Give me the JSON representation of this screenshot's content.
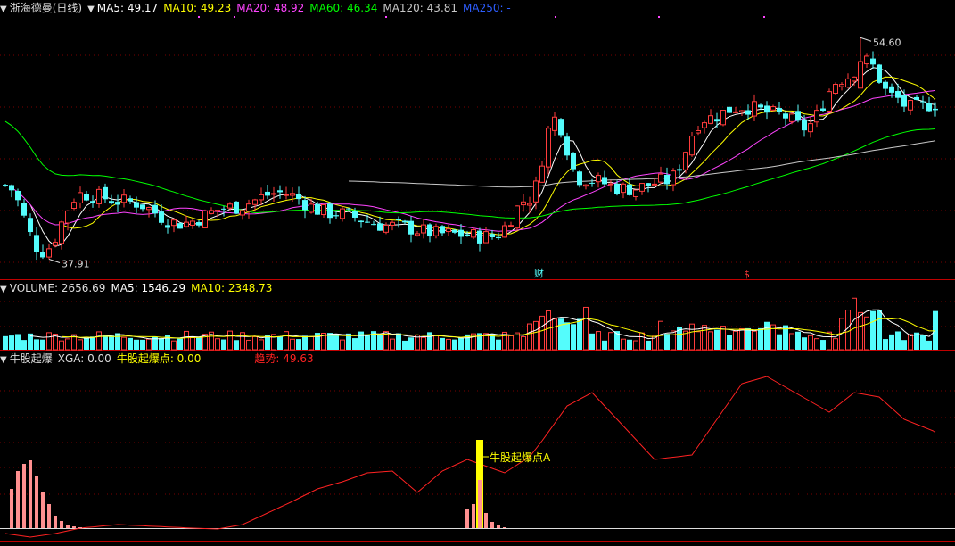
{
  "header": {
    "stock_name": "浙海德曼(日线)",
    "ma5": "MA5: 49.17",
    "ma10": "MA10: 49.23",
    "ma20": "MA20: 48.92",
    "ma60": "MA60: 46.34",
    "ma120": "MA120: 43.81",
    "ma250": "MA250: -"
  },
  "volume_header": {
    "title": "VOLUME: 2656.69",
    "ma5": "MA5: 1546.29",
    "ma10": "MA10: 2348.73"
  },
  "indicator_header": {
    "title": "牛股起爆",
    "xga": "XGA: 0.00",
    "point": "牛股起爆点: 0.00",
    "trend": "趋势: 49.63"
  },
  "price_panel": {
    "high_label": "54.60",
    "low_label": "37.91",
    "marker_cai": "财",
    "marker_s": "$"
  },
  "indicator_panel": {
    "annotation": "牛股起爆点A"
  },
  "colors": {
    "up": "#ff3c3c",
    "down": "#54fcfc",
    "ma5": "#ffffff",
    "ma10": "#ffff00",
    "ma20": "#ff44ff",
    "ma60": "#00ff00",
    "ma120": "#c8c8c8",
    "ma250": "#2d5dff",
    "trend": "#ff2222",
    "xga_bar": "#ff9090",
    "point_bar": "#ffff00",
    "grid": "#7a0000"
  },
  "chart_data": {
    "type": "candlestick",
    "price_range": [
      37.0,
      56.5
    ],
    "high": 54.6,
    "low": 37.91,
    "ma_series": [
      {
        "name": "MA5",
        "last": 49.17
      },
      {
        "name": "MA10",
        "last": 49.23
      },
      {
        "name": "MA20",
        "last": 48.92
      },
      {
        "name": "MA60",
        "last": 46.34
      },
      {
        "name": "MA120",
        "last": 43.81
      }
    ],
    "volume": {
      "last": 2656.69,
      "ma5": 1546.29,
      "ma10": 2348.73
    },
    "indicator": {
      "xga": 0.0,
      "point": 0.0,
      "trend": 49.63
    }
  }
}
